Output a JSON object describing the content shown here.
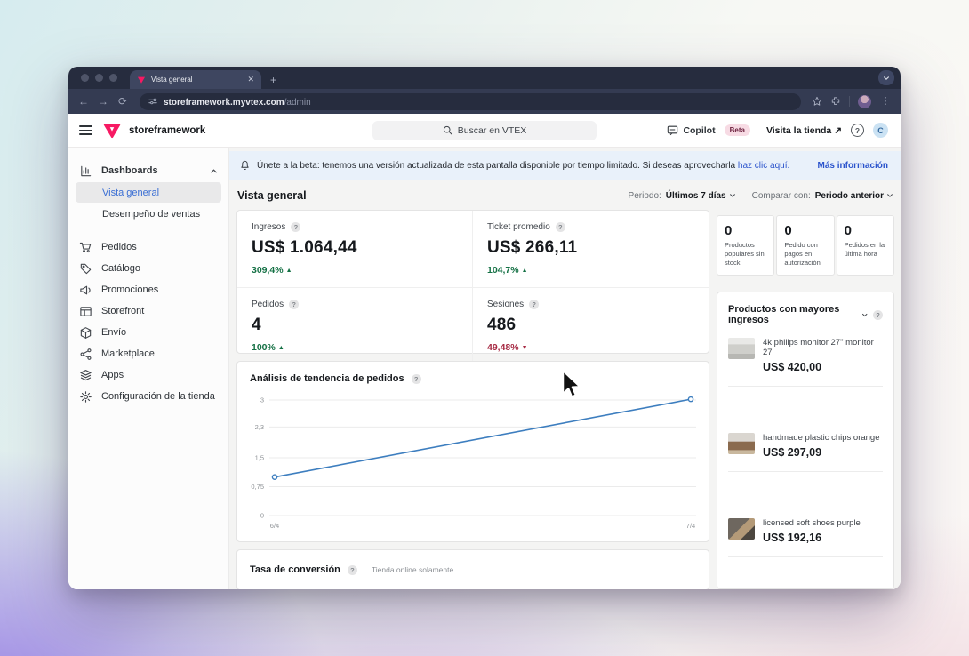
{
  "colors": {
    "accent_blue": "#3b6fd4",
    "link_blue": "#2a53cc",
    "green_up": "#157145",
    "red_down": "#a72b44",
    "vtex_pink": "#f71963",
    "chart_line": "#3d7ebf"
  },
  "browser": {
    "tab_title": "Vista general",
    "url_domain": "storeframework.myvtex.com",
    "url_path": "/admin"
  },
  "admin_header": {
    "brand": "storeframework",
    "search_placeholder": "Buscar en VTEX",
    "copilot_label": "Copilot",
    "copilot_badge": "Beta",
    "visit_store": "Visita la tienda ↗",
    "avatar_initial": "C"
  },
  "banner": {
    "text": "Únete a la beta: tenemos una versión actualizada de esta pantalla disponible por tiempo limitado. Si deseas aprovecharla",
    "link": "haz clic aquí.",
    "more_info": "Más información"
  },
  "sidebar": {
    "items": [
      {
        "label": "Dashboards",
        "icon": "dashboards",
        "type": "head",
        "chevron": "up"
      },
      {
        "label": "Vista general",
        "type": "sub",
        "selected": true
      },
      {
        "label": "Desempeño de ventas",
        "type": "sub"
      },
      {
        "label": "",
        "type": "gap"
      },
      {
        "label": "Pedidos",
        "icon": "orders"
      },
      {
        "label": "Catálogo",
        "icon": "catalog"
      },
      {
        "label": "Promociones",
        "icon": "promotions"
      },
      {
        "label": "Storefront",
        "icon": "storefront"
      },
      {
        "label": "Envío",
        "icon": "shipping"
      },
      {
        "label": "Marketplace",
        "icon": "marketplace"
      },
      {
        "label": "Apps",
        "icon": "apps"
      },
      {
        "label": "Configuración de la tienda",
        "icon": "settings"
      }
    ]
  },
  "page": {
    "title": "Vista general",
    "period_label": "Periodo:",
    "period_value": "Últimos 7 días",
    "compare_label": "Comparar con:",
    "compare_value": "Periodo anterior"
  },
  "kpis": [
    {
      "label": "Ingresos",
      "value": "US$ 1.064,44",
      "delta": "309,4%",
      "direction": "up"
    },
    {
      "label": "Ticket promedio",
      "value": "US$ 266,11",
      "delta": "104,7%",
      "direction": "up"
    },
    {
      "label": "Pedidos",
      "value": "4",
      "delta": "100%",
      "direction": "up"
    },
    {
      "label": "Sesiones",
      "value": "486",
      "delta": "49,48%",
      "direction": "down"
    }
  ],
  "right_panel": {
    "mini_cards": [
      {
        "value": "0",
        "label": "Productos populares sin stock"
      },
      {
        "value": "0",
        "label": "Pedido con pagos en autorización"
      },
      {
        "value": "0",
        "label": "Pedidos en la última hora"
      }
    ],
    "products": {
      "title": "Productos con mayores ingresos",
      "items": [
        {
          "name": "4k philips monitor 27\" monitor 27",
          "price": "US$ 420,00"
        },
        {
          "name": "handmade plastic chips orange",
          "price": "US$ 297,09"
        },
        {
          "name": "licensed soft shoes purple",
          "price": "US$ 192,16"
        }
      ]
    }
  },
  "conversion": {
    "title": "Tasa de conversión",
    "subtitle": "Tienda online solamente"
  },
  "chart_data": {
    "type": "line",
    "title": "Análisis de tendencia de pedidos",
    "x": [
      "6/4",
      "7/4"
    ],
    "series": [
      {
        "name": "Pedidos",
        "values": [
          1,
          3.02
        ]
      }
    ],
    "ylim": [
      0,
      3
    ],
    "yticks": [
      {
        "label": "3",
        "value": 3
      },
      {
        "label": "2,3",
        "value": 2.3
      },
      {
        "label": "1,5",
        "value": 1.5
      },
      {
        "label": "0,75",
        "value": 0.75
      },
      {
        "label": "0",
        "value": 0
      }
    ],
    "grid": true,
    "legend": false,
    "line_color": "#3d7ebf"
  }
}
